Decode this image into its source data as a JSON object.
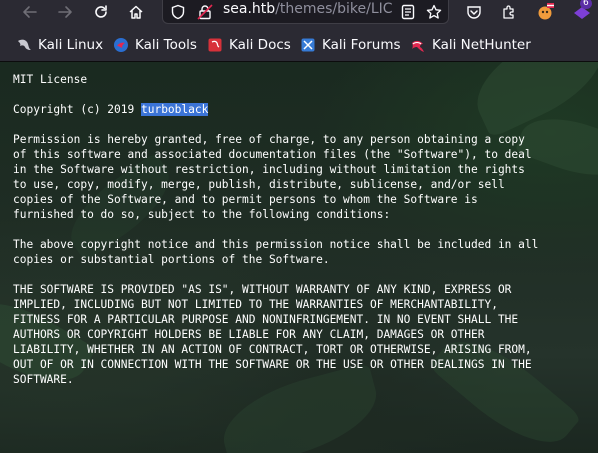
{
  "toolbar": {
    "back_icon": "arrow-left-icon",
    "forward_icon": "arrow-right-icon",
    "reload_icon": "reload-icon",
    "home_icon": "home-icon",
    "url_host": "sea.htb",
    "url_path": "/themes/bike/LIC",
    "shield_icon": "shield-icon",
    "lock_icon": "lock-warning-icon",
    "reader_icon": "reader-view-icon",
    "bookmark_star_icon": "star-icon",
    "pocket_icon": "pocket-icon",
    "extensions_icon": "extensions-icon",
    "badge_count": "6"
  },
  "bookmarks": [
    {
      "label": "Kali Linux",
      "icon": "kali-dragon-icon"
    },
    {
      "label": "Kali Tools",
      "icon": "kali-tools-icon"
    },
    {
      "label": "Kali Docs",
      "icon": "kali-docs-icon"
    },
    {
      "label": "Kali Forums",
      "icon": "kali-forums-icon"
    },
    {
      "label": "Kali NetHunter",
      "icon": "kali-nethunter-icon"
    }
  ],
  "license": {
    "title": "MIT License",
    "copyright_prefix": "Copyright (c) 2019 ",
    "copyright_holder": "turboblack",
    "para1": "Permission is hereby granted, free of charge, to any person obtaining a copy\nof this software and associated documentation files (the \"Software\"), to deal\nin the Software without restriction, including without limitation the rights\nto use, copy, modify, merge, publish, distribute, sublicense, and/or sell\ncopies of the Software, and to permit persons to whom the Software is\nfurnished to do so, subject to the following conditions:",
    "para2": "The above copyright notice and this permission notice shall be included in all\ncopies or substantial portions of the Software.",
    "para3": "THE SOFTWARE IS PROVIDED \"AS IS\", WITHOUT WARRANTY OF ANY KIND, EXPRESS OR\nIMPLIED, INCLUDING BUT NOT LIMITED TO THE WARRANTIES OF MERCHANTABILITY,\nFITNESS FOR A PARTICULAR PURPOSE AND NONINFRINGEMENT. IN NO EVENT SHALL THE\nAUTHORS OR COPYRIGHT HOLDERS BE LIABLE FOR ANY CLAIM, DAMAGES OR OTHER\nLIABILITY, WHETHER IN AN ACTION OF CONTRACT, TORT OR OTHERWISE, ARISING FROM,\nOUT OF OR IN CONNECTION WITH THE SOFTWARE OR THE USE OR OTHER DEALINGS IN THE\nSOFTWARE."
  },
  "colors": {
    "toolbar_bg": "#2b2a33",
    "selection": "#3b74d7",
    "text": "#ffffff"
  }
}
